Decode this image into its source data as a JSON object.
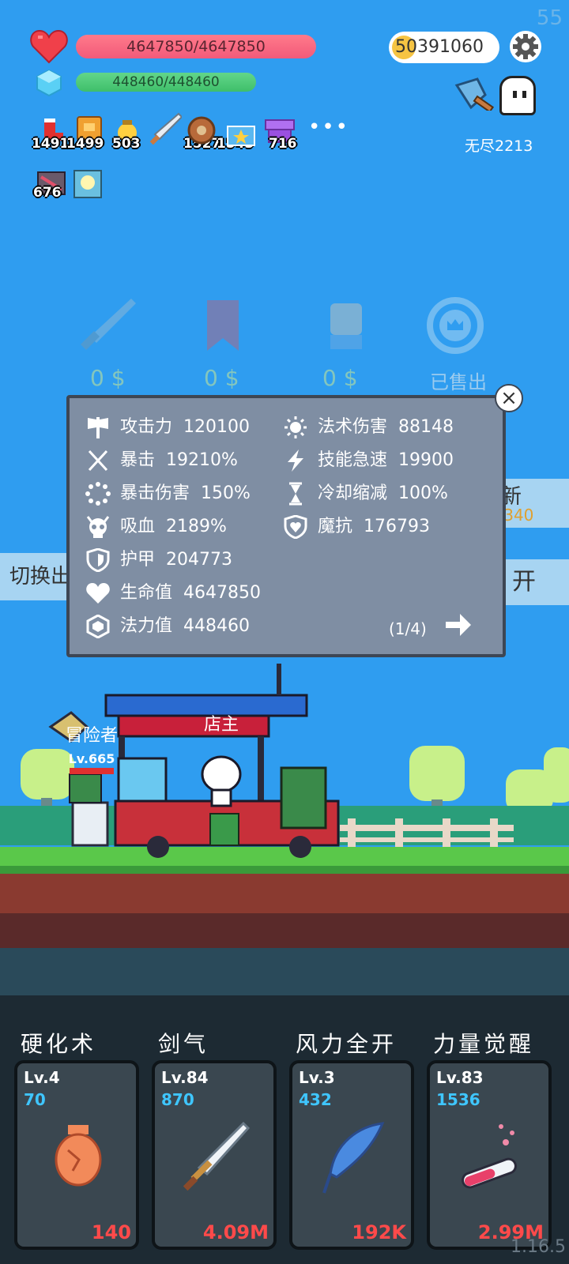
{
  "fps": "55",
  "hp": "4647850/4647850",
  "mp": "448460/448460",
  "gold": "50391060",
  "endless": "无尽2213",
  "items": [
    {
      "count": "1491"
    },
    {
      "count": "1499"
    },
    {
      "count": "503"
    },
    {
      "count": ""
    },
    {
      "count": "1527"
    },
    {
      "count": "1543"
    },
    {
      "count": "716"
    },
    {
      "count": "676"
    },
    {
      "count": ""
    }
  ],
  "shop": {
    "prices": [
      "0 $",
      "0 $",
      "0 $"
    ],
    "sold": "已售出"
  },
  "side": {
    "refresh": "新",
    "refresh_num": "-340",
    "switch": "切换出",
    "open": "开"
  },
  "stats_panel": {
    "left": [
      {
        "label": "攻击力",
        "value": "120100",
        "icon": "axe-icon"
      },
      {
        "label": "暴击",
        "value": "19210%",
        "icon": "crossed-swords-icon"
      },
      {
        "label": "暴击伤害",
        "value": "150%",
        "icon": "crit-ring-icon"
      },
      {
        "label": "吸血",
        "value": "2189%",
        "icon": "skull-icon"
      },
      {
        "label": "护甲",
        "value": "204773",
        "icon": "shield-icon"
      },
      {
        "label": "生命值",
        "value": "4647850",
        "icon": "heart-icon"
      },
      {
        "label": "法力值",
        "value": "448460",
        "icon": "gem-icon"
      }
    ],
    "right": [
      {
        "label": "法术伤害",
        "value": "88148",
        "icon": "sun-icon"
      },
      {
        "label": "技能急速",
        "value": "19900",
        "icon": "lightning-icon"
      },
      {
        "label": "冷却缩减",
        "value": "100%",
        "icon": "hourglass-icon"
      },
      {
        "label": "魔抗",
        "value": "176793",
        "icon": "heart-shield-icon"
      }
    ],
    "page": "(1/4)"
  },
  "scene": {
    "shop_sign": "店主",
    "player_name": "冒险者",
    "player_level": "Lv.665"
  },
  "skills": [
    {
      "name": "硬化术",
      "level": "Lv.4",
      "value": "70",
      "cost": "140"
    },
    {
      "name": "剑气",
      "level": "Lv.84",
      "value": "870",
      "cost": "4.09M"
    },
    {
      "name": "风力全开",
      "level": "Lv.3",
      "value": "432",
      "cost": "192K"
    },
    {
      "name": "力量觉醒",
      "level": "Lv.83",
      "value": "1536",
      "cost": "2.99M"
    }
  ],
  "version": "1.16.5",
  "colors": {
    "sky": "#2f9df0",
    "hp": "#f25a7a",
    "mp": "#3fbf6a",
    "panel": "#7f8ea3",
    "cost": "#ff4a4a",
    "skill_value": "#3fc6ff"
  }
}
